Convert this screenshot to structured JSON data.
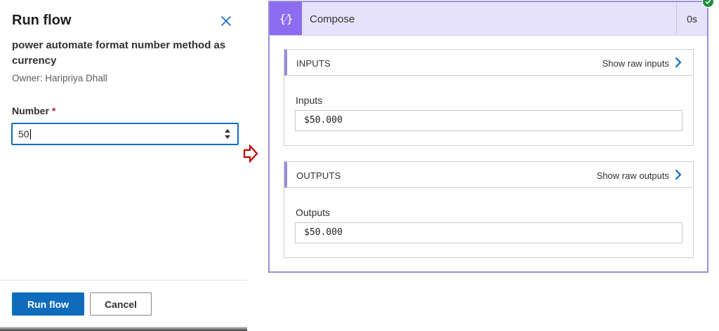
{
  "run_panel": {
    "title": "Run flow",
    "flow_name": "power automate format number method as currency",
    "owner": "Owner: Haripriya Dhall",
    "field": {
      "label": "Number",
      "required_marker": "*",
      "value": "50"
    },
    "buttons": {
      "run": "Run flow",
      "cancel": "Cancel"
    }
  },
  "compose": {
    "icon_glyph": "{⁄}",
    "title": "Compose",
    "duration": "0s",
    "status": "succeeded",
    "inputs": {
      "section_title": "INPUTS",
      "raw_link": "Show raw inputs",
      "field_label": "Inputs",
      "value": "$50.000"
    },
    "outputs": {
      "section_title": "OUTPUTS",
      "raw_link": "Show raw outputs",
      "field_label": "Outputs",
      "value": "$50.000"
    }
  },
  "colors": {
    "primary_button": "#0f6cbd",
    "compose_accent": "#8c6cf0",
    "compose_header_bg": "#e7e2fb",
    "arrow": "#c00000",
    "success": "#1e8e3e",
    "required": "#a4262c"
  },
  "icons": {
    "close": "close-icon",
    "stepper": "stepper-icon",
    "arrow": "arrow-right-outline-icon",
    "compose": "compose-curly-braces-icon",
    "chevron": "chevron-right-icon",
    "success": "checkmark-circle-icon"
  }
}
